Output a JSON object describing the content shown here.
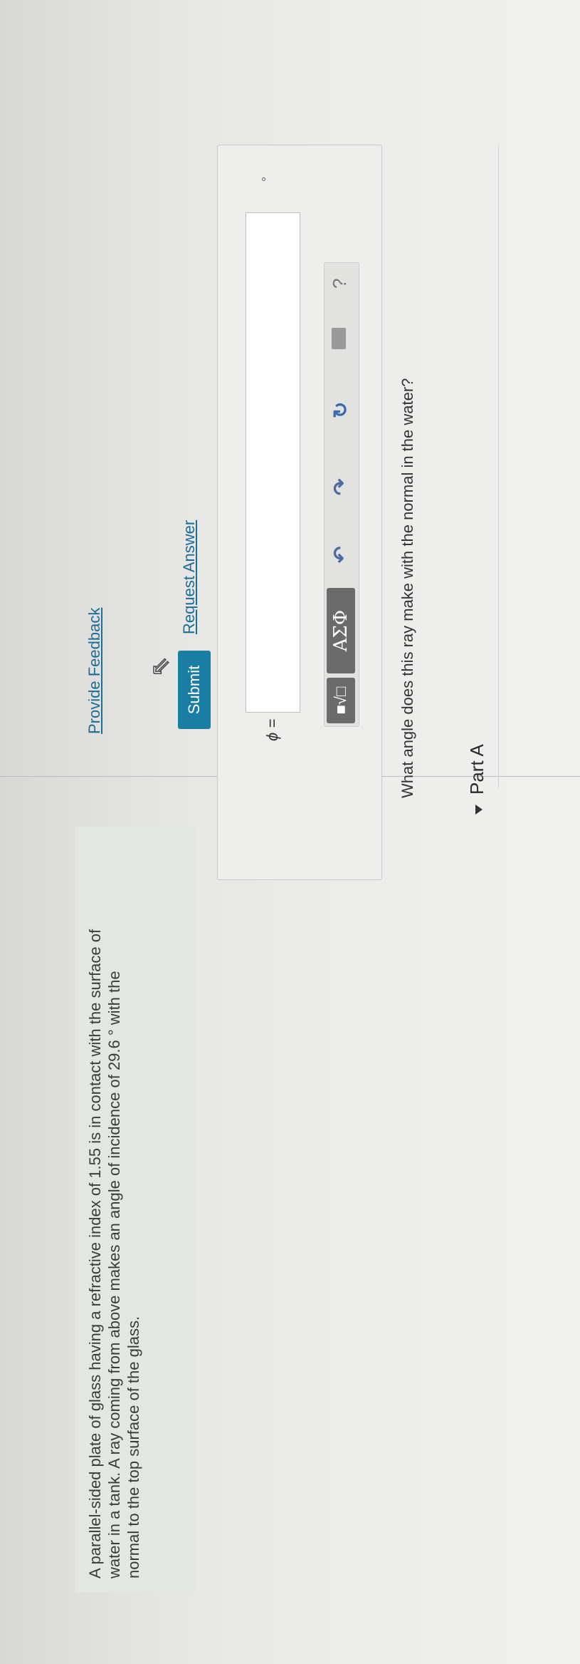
{
  "problem": {
    "line1": "A parallel-sided plate of glass having a refractive index of 1.55 is in contact with the surface of",
    "line2": "water in a tank. A ray coming from above makes an angle of incidence of 29.6 ° with the",
    "line3": "normal to the top surface of the glass."
  },
  "part": {
    "title": "Part A",
    "question": "What angle does this ray make with the normal in the water?"
  },
  "toolbar": {
    "templates_icon": "templates-icon",
    "greek_label": "ΑΣΦ",
    "undo_glyph": "↶",
    "redo_glyph": "↷",
    "reset_glyph": "↻",
    "keyboard_icon": "keyboard-icon",
    "help_glyph": "?"
  },
  "answer": {
    "variable_label": "ϕ =",
    "value": "",
    "unit": "°"
  },
  "actions": {
    "submit_label": "Submit",
    "request_answer_label": "Request Answer"
  },
  "footer": {
    "feedback_label": "Provide Feedback"
  },
  "colors": {
    "accent": "#1a7da3",
    "link": "#1b6d95",
    "tool_button": "#6b6b6b"
  }
}
